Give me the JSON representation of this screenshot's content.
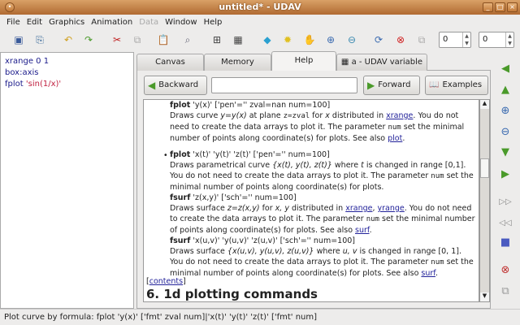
{
  "window": {
    "title": "untitled* - UDAV"
  },
  "menu": [
    "File",
    "Edit",
    "Graphics",
    "Animation",
    "Data",
    "Window",
    "Help"
  ],
  "toolbar": {
    "spin1": "0",
    "spin2": "0"
  },
  "editor": {
    "lines": [
      {
        "cmd": "xrange 0 1",
        "arg": ""
      },
      {
        "cmd": "box:axis",
        "arg": ""
      },
      {
        "cmd": "fplot ",
        "arg": "'sin(1/x)'"
      }
    ]
  },
  "tabs": [
    "Canvas",
    "Memory",
    "Help",
    "a - UDAV variable"
  ],
  "nav": {
    "backward": "Backward",
    "forward": "Forward",
    "examples": "Examples",
    "search_value": ""
  },
  "help": {
    "e1_name": "fplot",
    "e1_sig": " 'y(x)' ['pen'='' zval=nan num=100]",
    "e1_a": "Draws curve ",
    "e1_b": "y=y(x)",
    "e1_c": " at plane ",
    "e1_d": "z=zval",
    "e1_e": " for ",
    "e1_f": "x",
    "e1_g": " distributed in ",
    "e1_link": "xrange",
    "e1_h": ". You do not need to create the data arrays to plot it. The parameter ",
    "e1_num": "num",
    "e1_i": " set the minimal number of points along coordinate(s) for plots. See also ",
    "e1_link2": "plot",
    "e1_j": ".",
    "e2_name": "fplot",
    "e2_sig": " 'x(t)' 'y(t)' 'z(t)' ['pen'='' num=100]",
    "e2_a": "Draws parametrical curve ",
    "e2_b": "{x(t), y(t), z(t)}",
    "e2_c": " where ",
    "e2_d": "t",
    "e2_e": " is changed in range [0,1]. You do not need to create the data arrays to plot it. The parameter ",
    "e2_num": "num",
    "e2_f": " set the minimal number of points along coordinate(s) for plots.",
    "e3_name": "fsurf",
    "e3_sig": " 'z(x,y)' ['sch'='' num=100]",
    "e3_a": "Draws surface ",
    "e3_b": "z=z(x,y)",
    "e3_c": " for ",
    "e3_d": "x, y",
    "e3_e": " distributed in ",
    "e3_link": "xrange",
    "e3_sep": ", ",
    "e3_link2": "yrange",
    "e3_f": ". You do not need to create the data arrays to plot it. The parameter ",
    "e3_num": "num",
    "e3_g": " set the minimal number of points along coordinate(s) for plots. See also ",
    "e3_link3": "surf",
    "e3_h": ".",
    "e4_name": "fsurf",
    "e4_sig": " 'x(u,v)' 'y(u,v)' 'z(u,v)' ['sch'='' num=100]",
    "e4_a": "Draws surface ",
    "e4_b": "{x(u,v), y(u,v), z(u,v)}",
    "e4_c": " where ",
    "e4_d": "u, v",
    "e4_e": " is changed in range [0, 1]. You do not need to create the data arrays to plot it. The parameter ",
    "e4_num": "num",
    "e4_f": " set the minimal number of points along coordinate(s) for plots. See also ",
    "e4_link": "surf",
    "e4_g": ".",
    "contents_link": "contents",
    "heading": "6. 1d plotting commands"
  },
  "status": "Plot curve by formula: fplot 'y(x)' ['fmt' zval num]|'x(t)' 'y(t)' 'z(t)' ['fmt' num]"
}
